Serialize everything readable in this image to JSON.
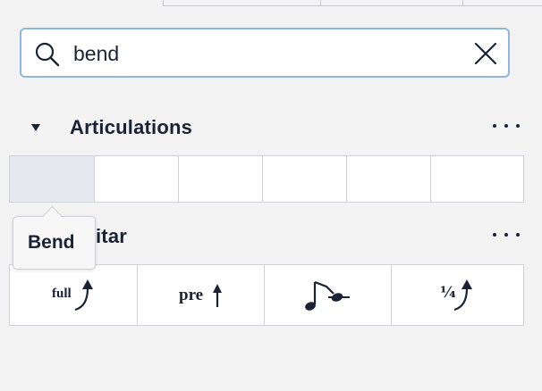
{
  "search": {
    "value": "bend",
    "placeholder": ""
  },
  "sections": [
    {
      "title": "Articulations",
      "expanded": true,
      "cells": 6
    },
    {
      "title": "Guitar",
      "title_visible": "itar"
    }
  ],
  "tooltip": {
    "text": "Bend"
  },
  "guitar_items": [
    {
      "icon": "full-bend-icon",
      "text": "full"
    },
    {
      "icon": "pre-bend-icon",
      "text": "pre"
    },
    {
      "icon": "grace-note-bend-icon"
    },
    {
      "icon": "quarter-bend-icon",
      "text": "¼"
    }
  ],
  "colors": {
    "accent": "#8fb5e3",
    "text": "#1b2235",
    "hover": "#e5e8ee",
    "background": "#f3f3f3"
  }
}
